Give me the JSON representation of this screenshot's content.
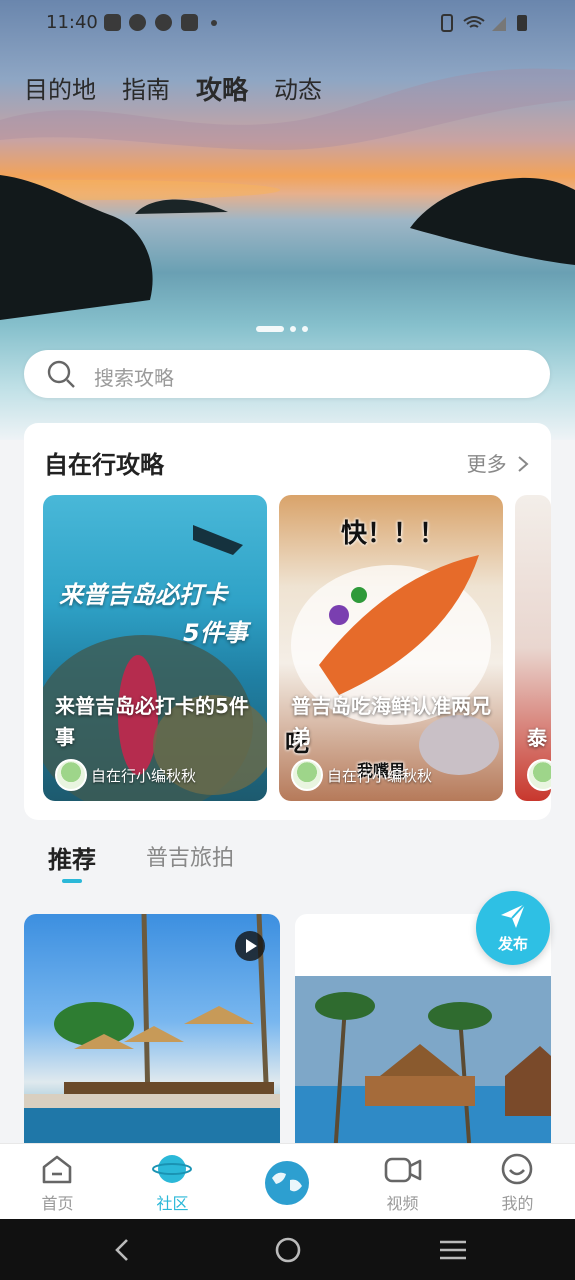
{
  "status_bar": {
    "time": "11:40"
  },
  "top_nav": {
    "tabs": [
      {
        "label": "目的地"
      },
      {
        "label": "指南"
      },
      {
        "label": "攻略"
      },
      {
        "label": "动态"
      }
    ],
    "active_index": 2
  },
  "banner": {
    "dots": 3,
    "active_dot": 0
  },
  "search": {
    "placeholder": "搜索攻略"
  },
  "guides_section": {
    "title": "自在行攻略",
    "more_label": "更多",
    "items": [
      {
        "image_text_line1": "来普吉岛必打卡",
        "image_text_line2": "5件事",
        "label": "来普吉岛必打卡的5件事",
        "author": "自在行小编秋秋"
      },
      {
        "image_text": "快！！！",
        "image_text2": "吃",
        "image_text3": "我嘴里",
        "label": "普吉岛吃海鲜认准两兄弟",
        "author": "自在行小编秋秋"
      },
      {
        "label": "泰"
      }
    ]
  },
  "feed_tabs": {
    "tabs": [
      {
        "label": "推荐"
      },
      {
        "label": "普吉旅拍"
      }
    ],
    "active_index": 0
  },
  "fab": {
    "label": "发布"
  },
  "bottom_nav": {
    "items": [
      {
        "label": "首页"
      },
      {
        "label": "社区"
      },
      {
        "label": ""
      },
      {
        "label": "视频"
      },
      {
        "label": "我的"
      }
    ],
    "active_index": 1
  },
  "colors": {
    "accent": "#2bb8d8",
    "fab": "#2ec0e4"
  }
}
